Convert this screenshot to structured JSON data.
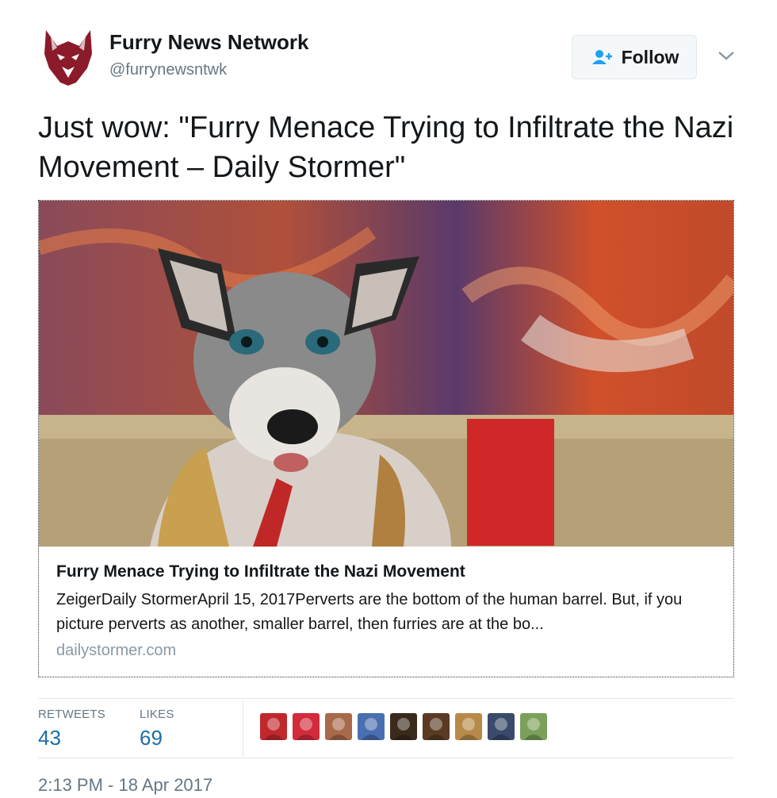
{
  "account": {
    "name": "Furry News Network",
    "handle": "@furrynewsntwk",
    "avatar_icon": "wolf-head-icon"
  },
  "follow_button": {
    "label": "Follow",
    "icon": "add-user-icon"
  },
  "menu_caret_icon": "chevron-down-icon",
  "tweet_text": "Just wow:  \"Furry Menace Trying to Infiltrate the Nazi Movement – Daily Stormer\"",
  "link_card": {
    "title": "Furry Menace Trying to Infiltrate the Nazi Movement",
    "description": "ZeigerDaily StormerApril 15, 2017Perverts are the bottom of the human barrel. But, if you picture perverts as another, smaller barrel, then furries are at the bo...",
    "domain": "dailystormer.com"
  },
  "stats": {
    "retweets": {
      "label": "RETWEETS",
      "value": "43"
    },
    "likes": {
      "label": "LIKES",
      "value": "69"
    }
  },
  "likers": [
    {
      "icon": "red-dragon-avatar",
      "color": "#c0282e"
    },
    {
      "icon": "red-badge-avatar",
      "color": "#d12b3c"
    },
    {
      "icon": "brown-dog-avatar",
      "color": "#a86a4a"
    },
    {
      "icon": "blue-fox-avatar",
      "color": "#4a6fb0"
    },
    {
      "icon": "dark-character-avatar",
      "color": "#3a2a1c"
    },
    {
      "icon": "brown-portrait-avatar",
      "color": "#5a3a22"
    },
    {
      "icon": "blonde-character-avatar",
      "color": "#b88a4a"
    },
    {
      "icon": "blue-wolf-avatar",
      "color": "#3a4a6a"
    },
    {
      "icon": "white-green-avatar",
      "color": "#7aa05a"
    }
  ],
  "timestamp": "2:13 PM - 18 Apr 2017",
  "colors": {
    "link_blue": "#1b6fa8",
    "muted": "#657786",
    "brand_maroon": "#8b1a2b"
  }
}
